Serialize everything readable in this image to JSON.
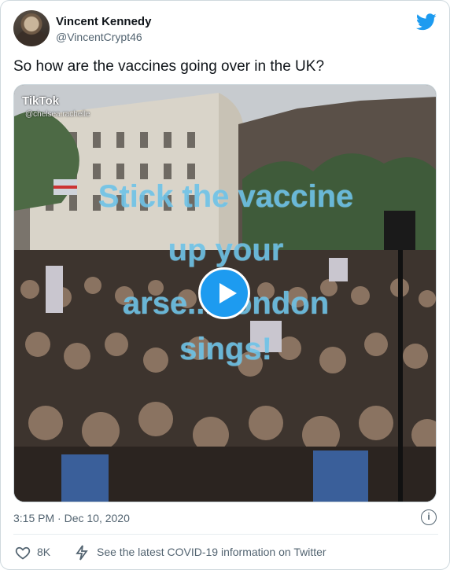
{
  "author": {
    "name": "Vincent Kennedy",
    "handle": "@VincentCrypt46"
  },
  "tweet": {
    "text": "So how are the vaccines going over in the UK?"
  },
  "media": {
    "watermark": "TikTok",
    "watermark_handle": "@chelsea.rachelle",
    "caption_lines": [
      "Stick the vaccine",
      "up your",
      "arse...London",
      "sings!"
    ],
    "caption_color": "#6ec3e8"
  },
  "meta": {
    "timestamp": "3:15 PM · Dec 10, 2020",
    "info_icon": "i"
  },
  "actions": {
    "like_count": "8K",
    "covid_link": "See the latest COVID-19 information on Twitter"
  },
  "colors": {
    "accent": "#1d9bf0",
    "secondary_text": "#536471"
  },
  "icons": [
    "twitter-bird-icon",
    "play-icon",
    "heart-icon",
    "bolt-icon",
    "info-icon",
    "tiktok-icon"
  ]
}
